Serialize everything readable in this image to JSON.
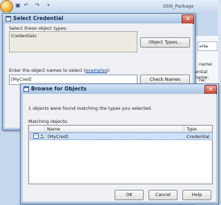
{
  "app": {
    "title": "SSIS_Package",
    "tab_button": "He",
    "labels": [
      "name:",
      "ential name:",
      "ne:"
    ]
  },
  "select_credential": {
    "title": "Select Credential",
    "object_types_label": "Select these object types:",
    "object_types_value": "Credentials",
    "object_types_button": "Object Types...",
    "names_label": "Enter the object names to select (",
    "examples_link": "examples",
    "names_label_end": "):",
    "names_value": "[MyCred]",
    "check_names_button": "Check Names"
  },
  "browse": {
    "title": "Browse for Objects",
    "status": "1 objects were found matching the types you selected.",
    "matching_label": "Matching objects:",
    "columns": [
      "Name",
      "Type"
    ],
    "rows": [
      {
        "name": "[MyCred]",
        "type": "Credential",
        "checked": true
      }
    ],
    "ok_button": "OK",
    "cancel_button": "Cancel",
    "help_button": "Help"
  },
  "icons": {
    "window_icon": "window-icon",
    "browse_icon": "browse-window-icon",
    "user_icon": "user-icon"
  }
}
